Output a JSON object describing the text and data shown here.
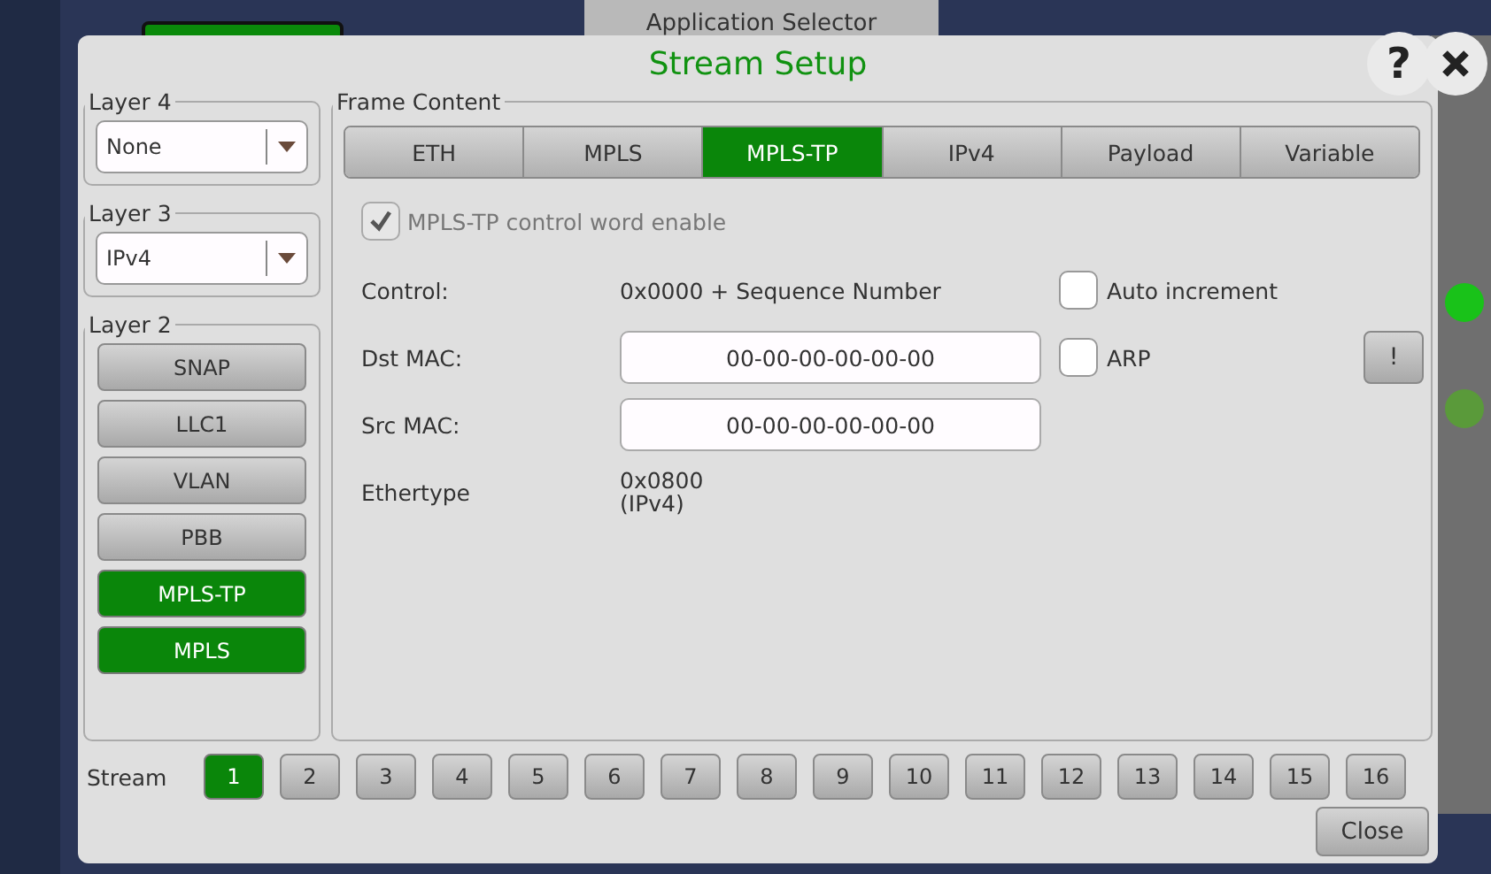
{
  "background": {
    "tab": "Application Selector"
  },
  "dialog": {
    "title": "Stream Setup",
    "layers": [
      {
        "title": "Layer 4",
        "kind": "select",
        "value": "None"
      },
      {
        "title": "Layer 3",
        "kind": "select",
        "value": "IPv4"
      },
      {
        "title": "Layer 2",
        "kind": "buttons",
        "buttons": [
          {
            "label": "SNAP",
            "selected": false
          },
          {
            "label": "LLC1",
            "selected": false
          },
          {
            "label": "VLAN",
            "selected": false
          },
          {
            "label": "PBB",
            "selected": false
          },
          {
            "label": "MPLS-TP",
            "selected": true
          },
          {
            "label": "MPLS",
            "selected": true
          }
        ]
      }
    ],
    "frame_content": {
      "title": "Frame Content",
      "tabs": [
        {
          "label": "ETH",
          "selected": false
        },
        {
          "label": "MPLS",
          "selected": false
        },
        {
          "label": "MPLS-TP",
          "selected": true
        },
        {
          "label": "IPv4",
          "selected": false
        },
        {
          "label": "Payload",
          "selected": false
        },
        {
          "label": "Variable",
          "selected": false
        }
      ],
      "control_word": {
        "label": "MPLS-TP control word enable",
        "checked": true,
        "disabled": true
      },
      "rows": [
        {
          "kind": "text",
          "label": "Control:",
          "value": "0x0000 + Sequence Number",
          "check": {
            "label": "Auto increment",
            "checked": false
          }
        },
        {
          "kind": "field",
          "label": "Dst MAC:",
          "value": "00-00-00-00-00-00",
          "check": {
            "label": "ARP",
            "checked": false
          },
          "button": "!"
        },
        {
          "kind": "field",
          "label": "Src MAC:",
          "value": "00-00-00-00-00-00"
        },
        {
          "kind": "multiline",
          "label": "Ethertype",
          "lines": [
            "0x0800",
            "(IPv4)"
          ]
        }
      ]
    },
    "stream": {
      "label": "Stream",
      "items": [
        {
          "label": "1",
          "selected": true
        },
        {
          "label": "2",
          "selected": false
        },
        {
          "label": "3",
          "selected": false
        },
        {
          "label": "4",
          "selected": false
        },
        {
          "label": "5",
          "selected": false
        },
        {
          "label": "6",
          "selected": false
        },
        {
          "label": "7",
          "selected": false
        },
        {
          "label": "8",
          "selected": false
        },
        {
          "label": "9",
          "selected": false
        },
        {
          "label": "10",
          "selected": false
        },
        {
          "label": "11",
          "selected": false
        },
        {
          "label": "12",
          "selected": false
        },
        {
          "label": "13",
          "selected": false
        },
        {
          "label": "14",
          "selected": false
        },
        {
          "label": "15",
          "selected": false
        },
        {
          "label": "16",
          "selected": false
        }
      ]
    },
    "close": "Close",
    "help": "?"
  }
}
